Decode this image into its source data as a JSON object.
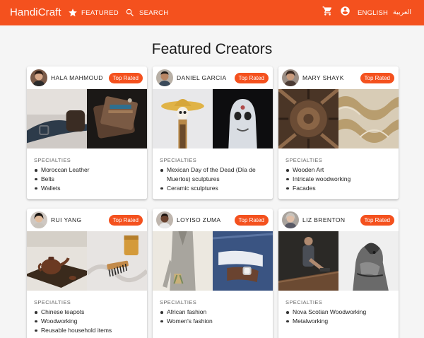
{
  "app": {
    "brand": "HandiCraft",
    "nav": {
      "featured": "FEATURED",
      "search": "SEARCH"
    },
    "icons": {
      "featured": "star-icon",
      "search": "search-icon",
      "cart": "shopping-cart-icon",
      "account": "account-circle-icon"
    },
    "languages": {
      "english": "ENGLISH",
      "arabic": "العربية"
    },
    "colors": {
      "accent": "#f4511e",
      "background": "#f5f5f5"
    }
  },
  "page": {
    "title": "Featured Creators"
  },
  "cards": [
    {
      "name": "HALA MAHMOUD",
      "badge": "Top Rated",
      "specialties_label": "SPECIALTIES",
      "specialties": [
        "Moroccan Leather",
        "Belts",
        "Wallets"
      ]
    },
    {
      "name": "DANIEL GARCIA",
      "badge": "Top Rated",
      "specialties_label": "SPECIALTIES",
      "specialties": [
        "Mexican Day of the Dead (Día de Muertos) sculptures",
        "Ceramic sculptures"
      ]
    },
    {
      "name": "MARY SHAYK",
      "badge": "Top Rated",
      "specialties_label": "SPECIALTIES",
      "specialties": [
        "Wooden Art",
        "Intricate woodworking",
        "Facades"
      ]
    },
    {
      "name": "RUI YANG",
      "badge": "Top Rated",
      "specialties_label": "SPECIALTIES",
      "specialties": [
        "Chinese teapots",
        "Woodworking",
        "Reusable household items"
      ]
    },
    {
      "name": "LOYISO ZUMA",
      "badge": "Top Rated",
      "specialties_label": "SPECIALTIES",
      "specialties": [
        "African fashion",
        "Women's fashion"
      ]
    },
    {
      "name": "LIZ BRENTON",
      "badge": "Top Rated",
      "specialties_label": "SPECIALTIES",
      "specialties": [
        "Nova Scotian Woodworking",
        "Metalworking"
      ]
    }
  ]
}
